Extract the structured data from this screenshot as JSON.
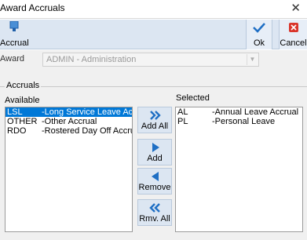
{
  "window": {
    "title": "Award Accruals"
  },
  "toolbar": {
    "accrual_label": "Accrual",
    "ok_label": "Ok",
    "cancel_label": "Cancel"
  },
  "award": {
    "label": "Award",
    "value": "ADMIN - Administration"
  },
  "accruals": {
    "group_label": "Accruals",
    "available_label": "Available",
    "selected_label": "Selected",
    "available_items": [
      {
        "code": "LSL",
        "name": "-Long Service Leave Accr"
      },
      {
        "code": "OTHER",
        "name": "-Other Accrual"
      },
      {
        "code": "RDO",
        "name": "-Rostered Day Off Accrua"
      }
    ],
    "selected_items": [
      {
        "code": "AL",
        "name": "-Annual Leave Accrual"
      },
      {
        "code": "PL",
        "name": "-Personal Leave"
      }
    ]
  },
  "buttons": {
    "add_all": "Add All",
    "add": "Add",
    "remove": "Remove",
    "remove_all": "Rmv. All"
  },
  "colors": {
    "toolbar_bg": "#dce6f2",
    "selection": "#0078d7",
    "icon_blue": "#1f6fc4",
    "cancel_red": "#d9352b"
  }
}
